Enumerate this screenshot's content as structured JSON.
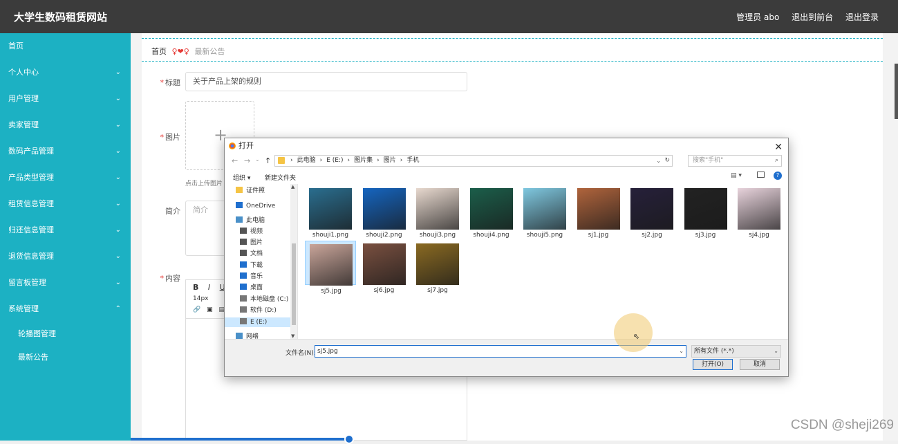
{
  "app": {
    "title": "大学生数码租赁网站",
    "user_label": "管理员 abo",
    "to_front_label": "退出到前台",
    "logout_label": "退出登录"
  },
  "sidebar": {
    "items": [
      {
        "label": "首页",
        "chevron": ""
      },
      {
        "label": "个人中心",
        "chevron": "⌄"
      },
      {
        "label": "用户管理",
        "chevron": "⌄"
      },
      {
        "label": "卖家管理",
        "chevron": "⌄"
      },
      {
        "label": "数码产品管理",
        "chevron": "⌄"
      },
      {
        "label": "产品类型管理",
        "chevron": "⌄"
      },
      {
        "label": "租赁信息管理",
        "chevron": "⌄"
      },
      {
        "label": "归还信息管理",
        "chevron": "⌄"
      },
      {
        "label": "退货信息管理",
        "chevron": "⌄"
      },
      {
        "label": "留言板管理",
        "chevron": "⌄"
      },
      {
        "label": "系统管理",
        "chevron": "⌃"
      }
    ],
    "sub_items": [
      {
        "label": "轮播图管理"
      },
      {
        "label": "最新公告"
      }
    ]
  },
  "breadcrumb": {
    "home": "首页",
    "separator": "♀❤♀",
    "current": "最新公告"
  },
  "form": {
    "title_label": "标题",
    "title_value": "关于产品上架的规则",
    "image_label": "图片",
    "upload_hint": "点击上传图片",
    "summary_label": "简介",
    "summary_placeholder": "简介",
    "content_label": "内容",
    "editor_font_size": "14px",
    "editor_bold": "B",
    "editor_italic": "I",
    "editor_underline": "U"
  },
  "dialog": {
    "title": "打开",
    "path": [
      "此电脑",
      "E (E:)",
      "图片集",
      "图片",
      "手机"
    ],
    "search_placeholder": "搜索\"手机\"",
    "organize_label": "组织 ▾",
    "new_folder_label": "新建文件夹",
    "nav_items": [
      {
        "label": "证件照",
        "icon": "folder-icon",
        "color": "#f5c445"
      },
      {
        "label": "OneDrive",
        "icon": "cloud-icon",
        "color": "#1f6fce"
      },
      {
        "label": "此电脑",
        "icon": "computer-icon",
        "color": "#4a90c8"
      },
      {
        "label": "视频",
        "icon": "video-icon",
        "color": "#555555"
      },
      {
        "label": "图片",
        "icon": "pictures-icon",
        "color": "#555555"
      },
      {
        "label": "文档",
        "icon": "documents-icon",
        "color": "#555555"
      },
      {
        "label": "下载",
        "icon": "download-icon",
        "color": "#1f6fce"
      },
      {
        "label": "音乐",
        "icon": "music-icon",
        "color": "#1f6fce"
      },
      {
        "label": "桌面",
        "icon": "desktop-icon",
        "color": "#1f6fce"
      },
      {
        "label": "本地磁盘 (C:)",
        "icon": "disk-icon",
        "color": "#777777"
      },
      {
        "label": "软件 (D:)",
        "icon": "disk-icon",
        "color": "#777777"
      },
      {
        "label": "E (E:)",
        "icon": "disk-icon",
        "color": "#777777"
      },
      {
        "label": "网络",
        "icon": "network-icon",
        "color": "#4a90c8"
      }
    ],
    "files": [
      {
        "name": "shouji1.png",
        "color": "#2a6e8f",
        "selected": false
      },
      {
        "name": "shouji2.png",
        "color": "#1565c0",
        "selected": false
      },
      {
        "name": "shouji3.png",
        "color": "#e8d9cf",
        "selected": false
      },
      {
        "name": "shouji4.png",
        "color": "#1b5e4a",
        "selected": false
      },
      {
        "name": "shouji5.png",
        "color": "#7fc8e0",
        "selected": false
      },
      {
        "name": "sj1.jpg",
        "color": "#b0643c",
        "selected": false
      },
      {
        "name": "sj2.jpg",
        "color": "#26203a",
        "selected": false
      },
      {
        "name": "sj3.jpg",
        "color": "#222222",
        "selected": false
      },
      {
        "name": "sj4.jpg",
        "color": "#e8d3dc",
        "selected": false
      },
      {
        "name": "sj5.jpg",
        "color": "#c9a59a",
        "selected": true
      },
      {
        "name": "sj6.jpg",
        "color": "#7a5040",
        "selected": false
      },
      {
        "name": "sj7.jpg",
        "color": "#8a6a22",
        "selected": false
      }
    ],
    "filename_label": "文件名(N):",
    "filename_value": "sj5.jpg",
    "filetype_value": "所有文件 (*.*)",
    "open_label": "打开(O)",
    "cancel_label": "取消"
  },
  "watermark": "CSDN @sheji269",
  "colors": {
    "accent": "#1cb1c3",
    "topbar": "#3b3b3b",
    "required": "#e53935",
    "selection": "#cce8ff"
  }
}
